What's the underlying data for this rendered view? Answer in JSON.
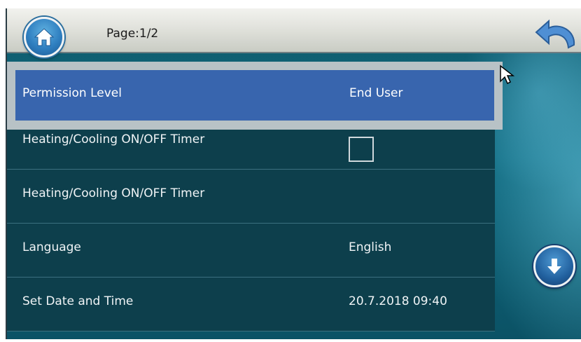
{
  "header": {
    "page_label": "Page:1/2",
    "home_icon": "home-icon",
    "back_icon": "undo-arrow-icon"
  },
  "settings": {
    "rows": [
      {
        "label": "Permission Level",
        "value": "End User",
        "selected": true
      },
      {
        "label": "Heating/Cooling ON/OFF Timer",
        "value": "",
        "control": "checkbox",
        "checked": false
      },
      {
        "label": "Heating/Cooling ON/OFF Timer",
        "value": ""
      },
      {
        "label": "Language",
        "value": "English"
      },
      {
        "label": "Set Date and Time",
        "value": "20.7.2018 09:40"
      }
    ]
  },
  "navigation": {
    "scroll_down_icon": "arrow-down-icon"
  },
  "colors": {
    "row_background": "#0d3f4c",
    "selected_row": "#3865ae",
    "topbar": "#e1e2dc"
  }
}
